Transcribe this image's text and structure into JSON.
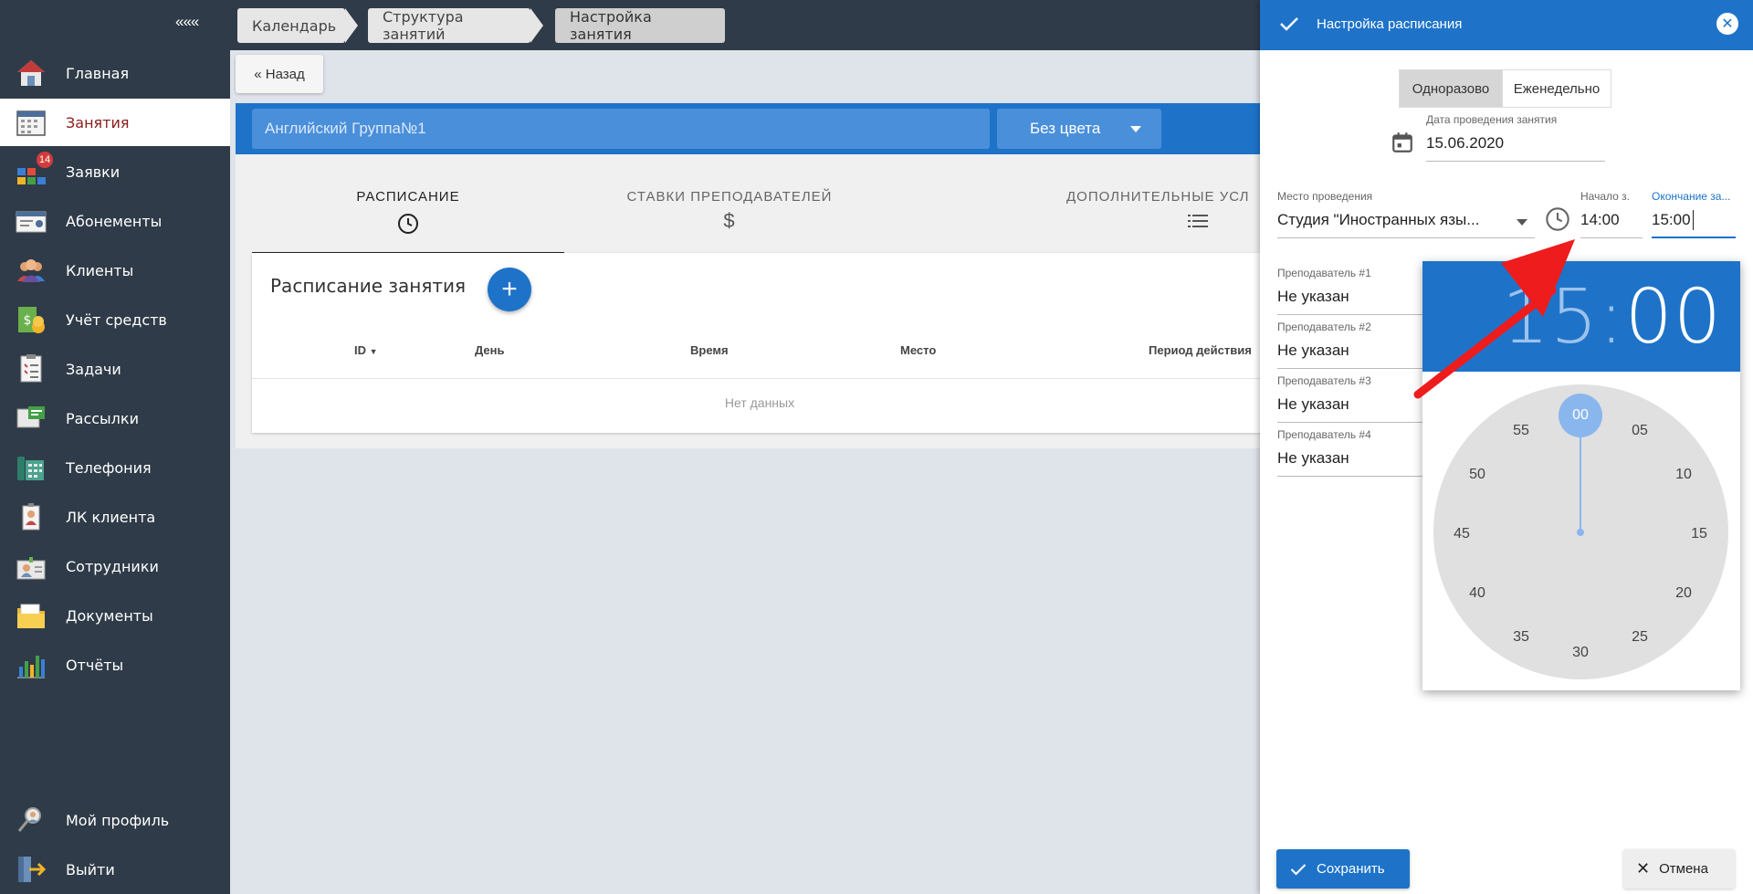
{
  "sidebar": {
    "collapse_label": "«««",
    "items": [
      {
        "label": "Главная",
        "icon": "home-icon"
      },
      {
        "label": "Занятия",
        "icon": "calendar-icon"
      },
      {
        "label": "Заявки",
        "icon": "requests-icon",
        "badge": "14"
      },
      {
        "label": "Абонементы",
        "icon": "card-icon"
      },
      {
        "label": "Клиенты",
        "icon": "clients-icon"
      },
      {
        "label": "Учёт средств",
        "icon": "money-icon"
      },
      {
        "label": "Задачи",
        "icon": "tasks-icon"
      },
      {
        "label": "Рассылки",
        "icon": "mailing-icon"
      },
      {
        "label": "Телефония",
        "icon": "phone-icon"
      },
      {
        "label": "ЛК клиента",
        "icon": "client-portal-icon"
      },
      {
        "label": "Сотрудники",
        "icon": "staff-icon"
      },
      {
        "label": "Документы",
        "icon": "documents-icon"
      },
      {
        "label": "Отчёты",
        "icon": "reports-icon"
      }
    ],
    "bottom_items": [
      {
        "label": "Мой профиль",
        "icon": "profile-icon"
      },
      {
        "label": "Выйти",
        "icon": "logout-icon"
      }
    ]
  },
  "breadcrumbs": [
    "Календарь",
    "Структура занятий",
    "Настройка занятия"
  ],
  "back_label": "« Назад",
  "lesson": {
    "name": "Английский Группа№1",
    "color": "Без цвета"
  },
  "tabs": [
    "РАСПИСАНИЕ",
    "СТАВКИ ПРЕПОДАВАТЕЛЕЙ",
    "ДОПОЛНИТЕЛЬНЫЕ УСЛ"
  ],
  "schedule": {
    "title": "Расписание занятия",
    "columns": [
      "ID",
      "День",
      "Время",
      "Место",
      "Период действия"
    ],
    "empty_text": "Нет данных"
  },
  "drawer": {
    "title": "Настройка расписания",
    "toggle_once": "Одноразово",
    "toggle_weekly": "Еженедельно",
    "date_label": "Дата проведения занятия",
    "date_value": "15.06.2020",
    "place_label": "Место проведения",
    "place_value": "Студия \"Иностранных язы...",
    "start_label": "Начало з...",
    "start_value": "14:00",
    "end_label": "Окончание за...",
    "end_value": "15:00",
    "teachers": [
      {
        "label": "Преподаватель #1",
        "value": "Не указан"
      },
      {
        "label": "Преподаватель #2",
        "value": "Не указан"
      },
      {
        "label": "Преподаватель #3",
        "value": "Не указан"
      },
      {
        "label": "Преподаватель #4",
        "value": "Не указан"
      }
    ],
    "save_label": "Сохранить",
    "cancel_label": "Отмена"
  },
  "time_picker": {
    "hours": "15",
    "separator": ":",
    "minutes": "00",
    "selected": "00",
    "dial": [
      "05",
      "10",
      "15",
      "20",
      "25",
      "30",
      "35",
      "40",
      "45",
      "50",
      "55"
    ]
  },
  "colors": {
    "sidebar": "#2f3b48",
    "accent": "#1e73c9",
    "active_label": "#8b1c1c",
    "annotation_arrow": "#ee1c1c"
  }
}
